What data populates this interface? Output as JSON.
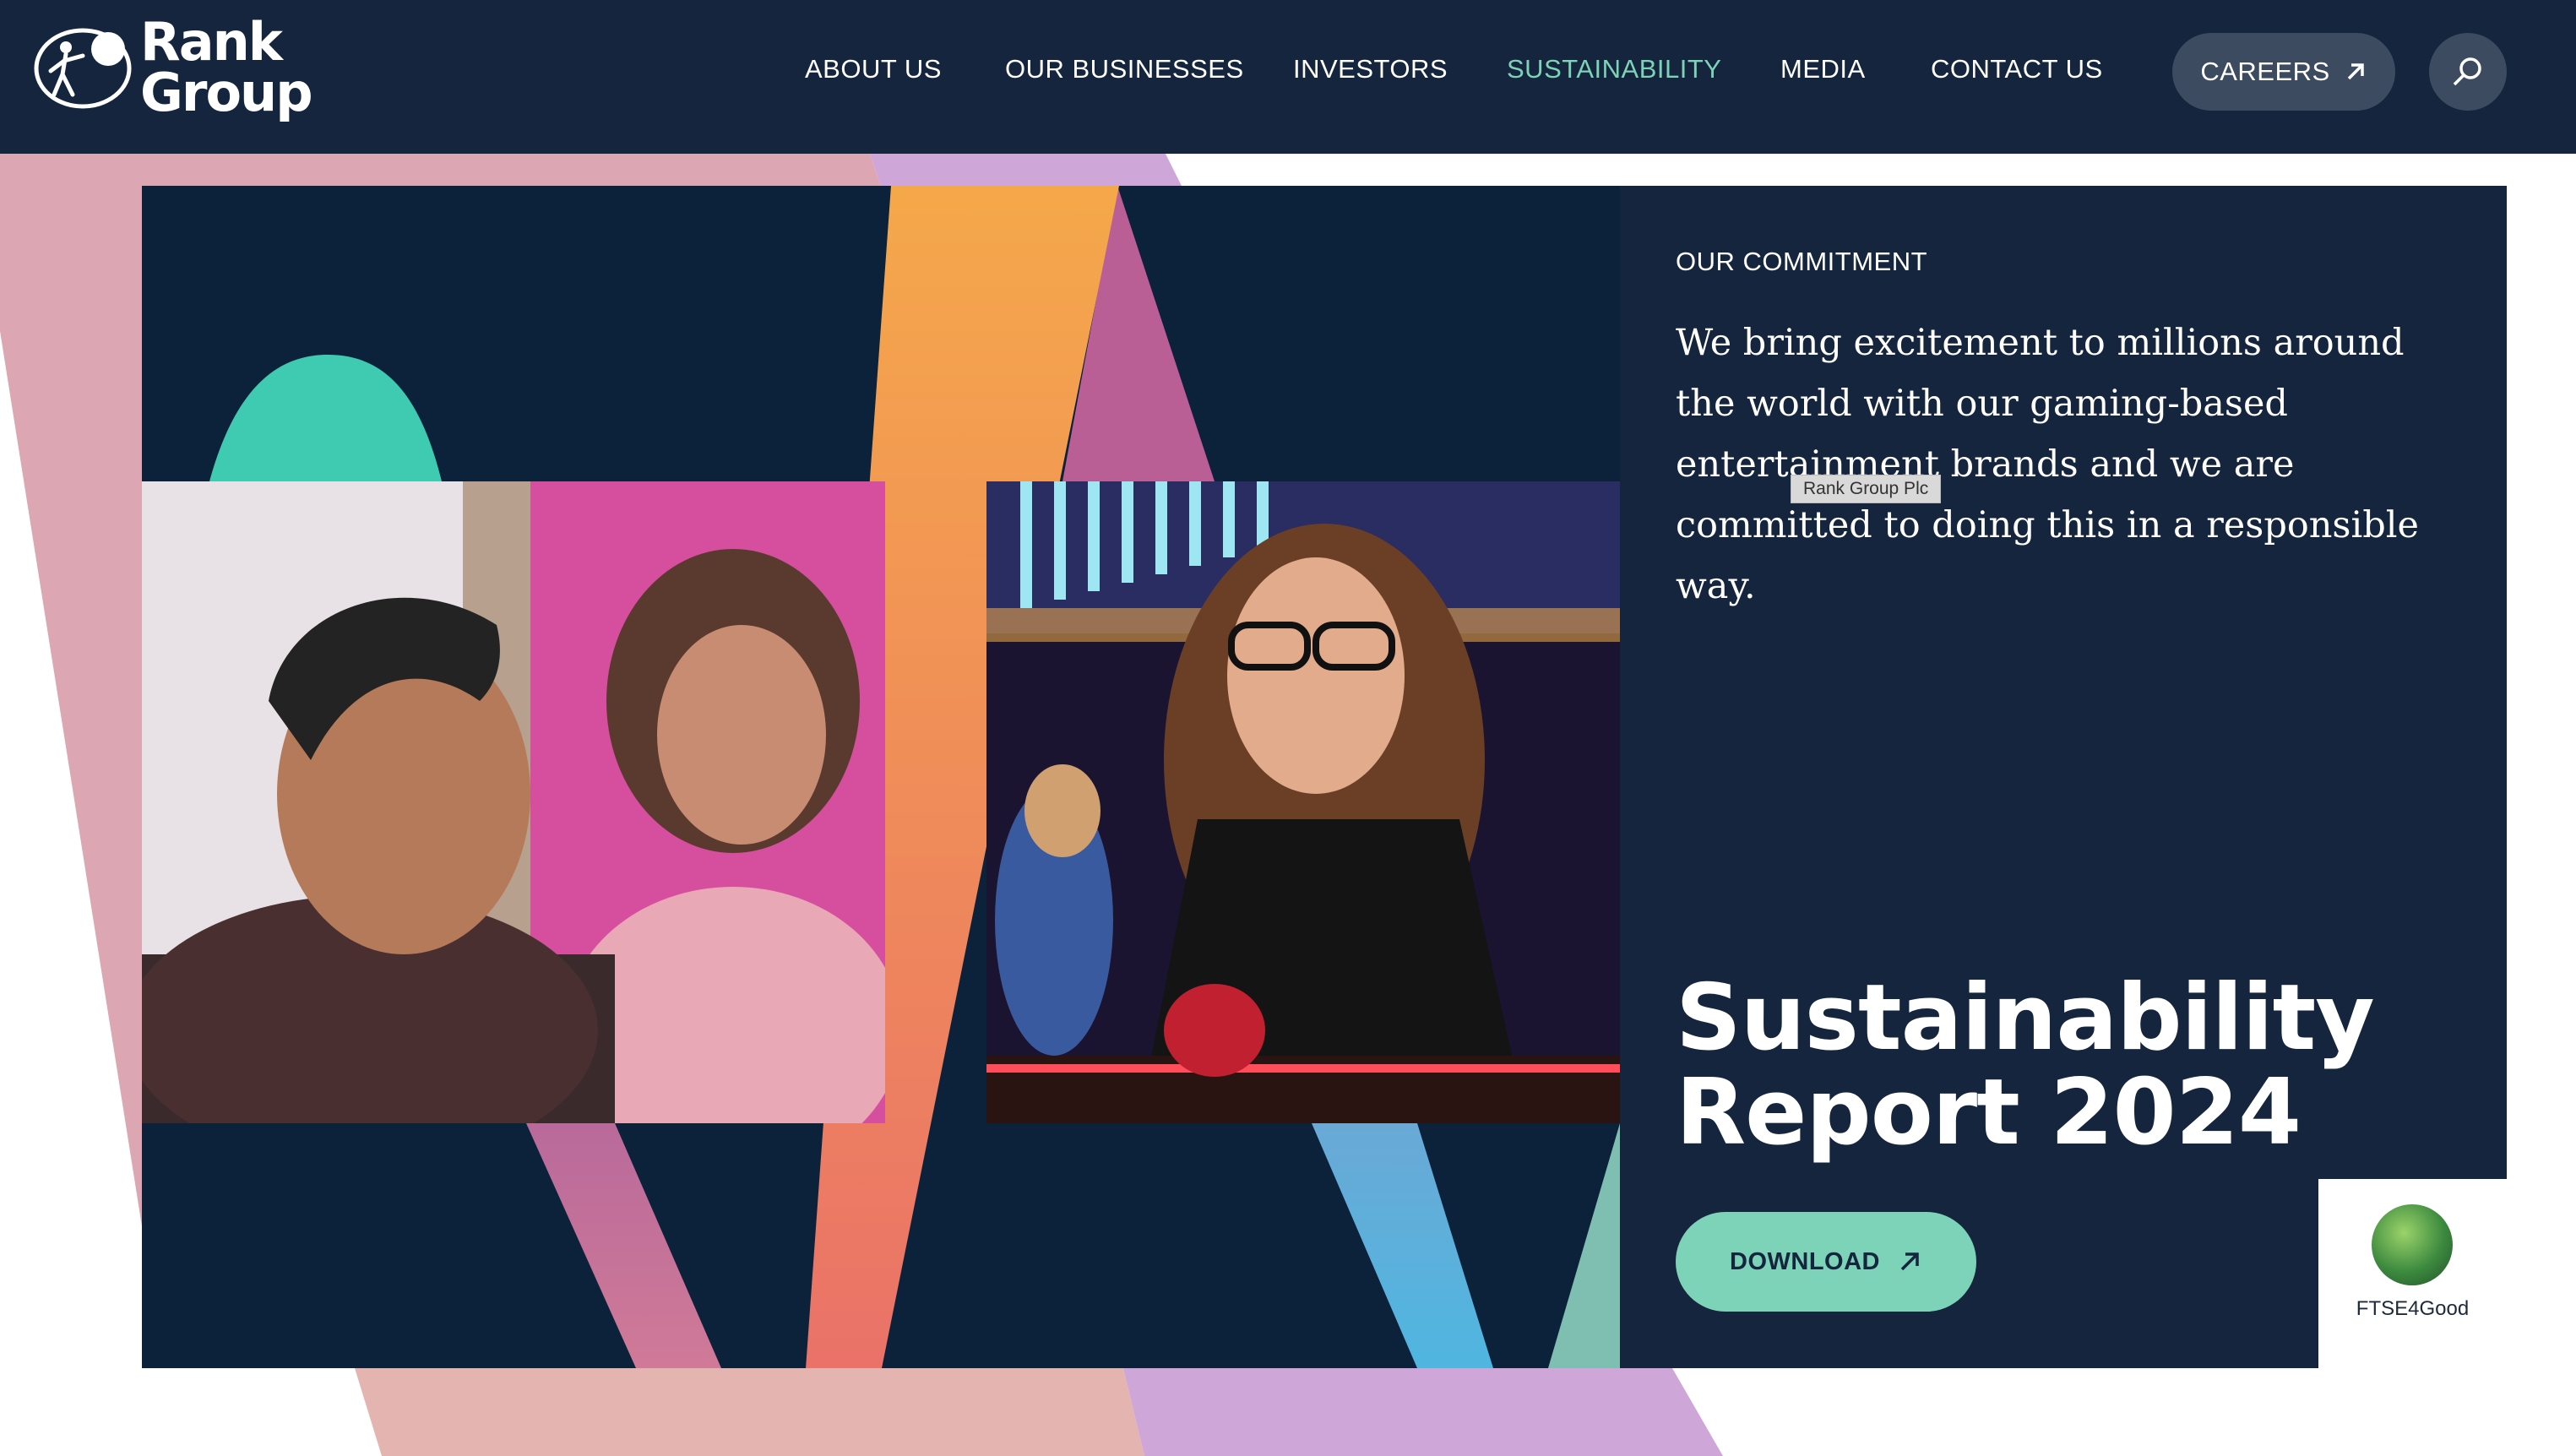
{
  "header": {
    "logo": {
      "line1": "Rank",
      "line2": "Group"
    },
    "nav": [
      {
        "label": "ABOUT US"
      },
      {
        "label": "OUR BUSINESSES"
      },
      {
        "label": "INVESTORS"
      },
      {
        "label": "SUSTAINABILITY",
        "active": true
      },
      {
        "label": "MEDIA"
      },
      {
        "label": "CONTACT US"
      }
    ],
    "careers_label": "CAREERS",
    "search_icon": "search-icon",
    "external_icon": "arrow-up-right-icon"
  },
  "hero": {
    "eyebrow": "OUR COMMITMENT",
    "commitment": "We bring excitement to millions around the world with our gaming-based entertainment brands and we are committed to doing this in a responsible way.",
    "tooltip": "Rank Group Plc",
    "title_line1": "Sustainability",
    "title_line2": "Report 2024",
    "download_label": "DOWNLOAD",
    "badge_label": "FTSE4Good"
  },
  "colors": {
    "navy": "#14253d",
    "accent_teal": "#7dd3b7",
    "orange": "#f2a24a",
    "pink": "#e2a7b6",
    "lilac": "#cfa6d8"
  }
}
